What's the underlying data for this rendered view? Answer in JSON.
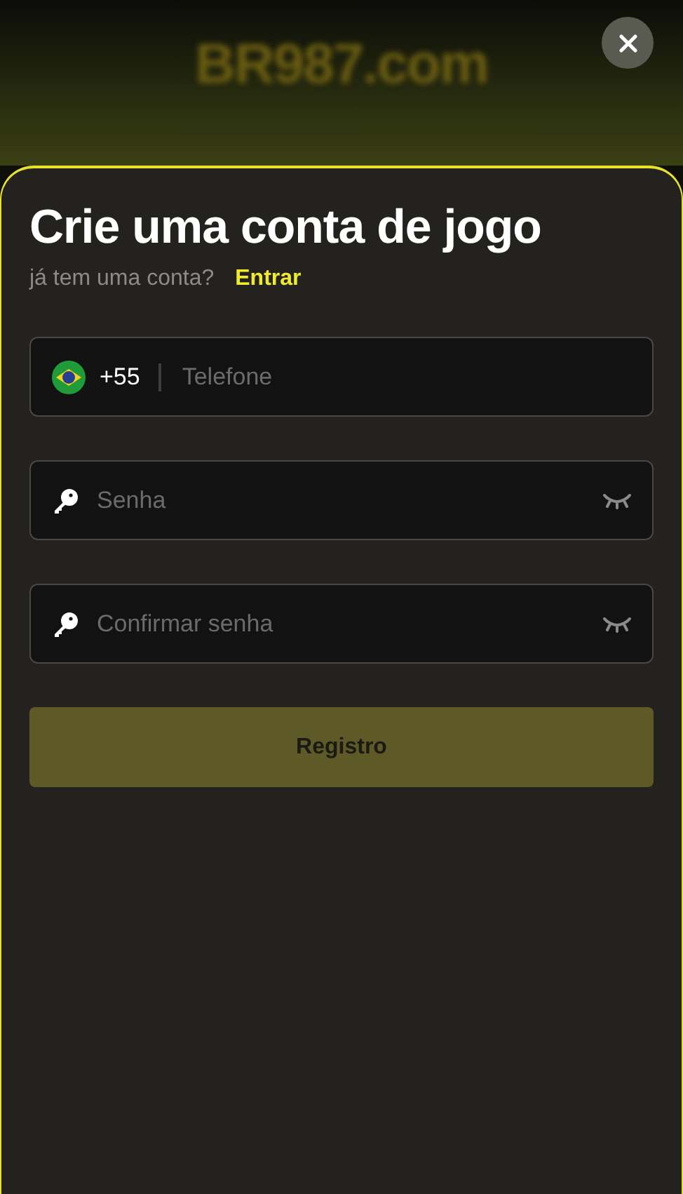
{
  "background": {
    "logo": "BR987.com"
  },
  "dialog": {
    "title": "Crie uma conta de jogo",
    "subtitle": "já tem uma conta?",
    "login_link": "Entrar",
    "phone_field": {
      "country_code": "+55",
      "placeholder": "Telefone"
    },
    "password_fields": [
      {
        "placeholder": "Senha"
      },
      {
        "placeholder": "Confirmar senha"
      }
    ],
    "submit_button": "Registro"
  }
}
